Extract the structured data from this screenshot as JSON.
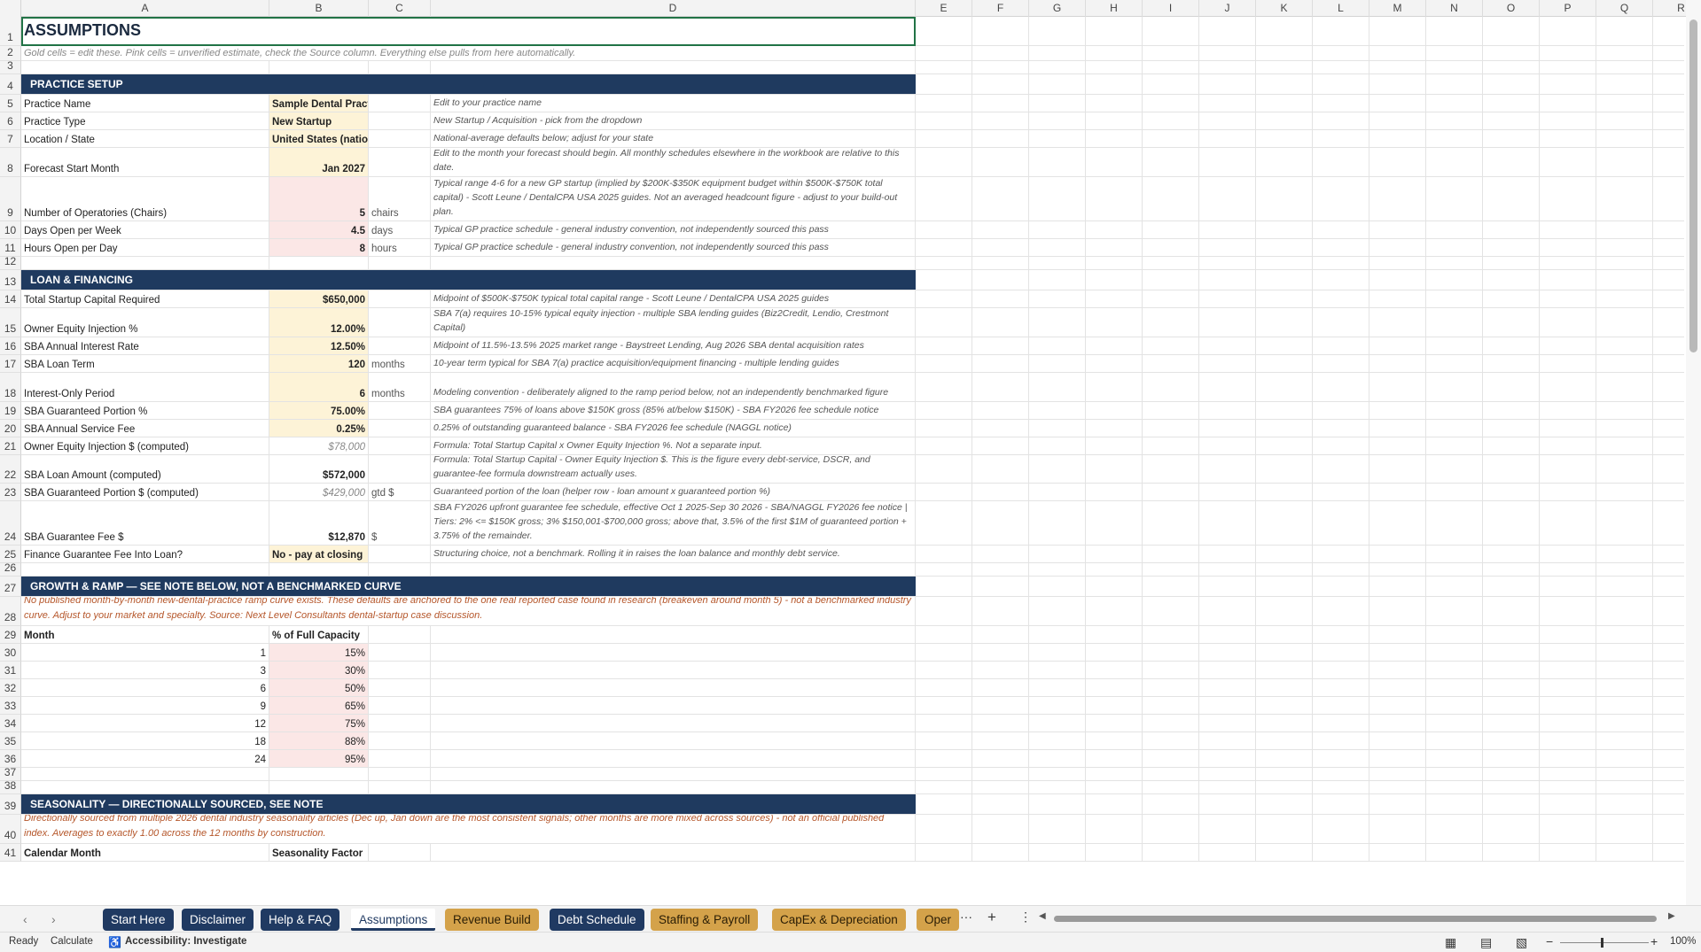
{
  "columns": [
    "A",
    "B",
    "C",
    "D",
    "E",
    "F",
    "G",
    "H",
    "I",
    "J",
    "K",
    "L",
    "M",
    "N",
    "O",
    "P",
    "Q",
    "R"
  ],
  "rows": [
    {
      "n": "1",
      "a": "ASSUMPTIONS",
      "kind": "title"
    },
    {
      "n": "2",
      "a": "Gold cells = edit these. Pink cells = unverified estimate, check the Source column. Everything else pulls from here automatically.",
      "kind": "subtitle"
    },
    {
      "n": "3",
      "kind": "blank"
    },
    {
      "n": "4",
      "a": "PRACTICE SETUP",
      "kind": "section"
    },
    {
      "n": "5",
      "a": "Practice Name",
      "b": "Sample Dental Practice",
      "bstyle": "gold-text",
      "d": "Edit to your practice name"
    },
    {
      "n": "6",
      "a": "Practice Type",
      "b": "New Startup",
      "bstyle": "gold-text",
      "d": "New Startup / Acquisition - pick from the dropdown"
    },
    {
      "n": "7",
      "a": "Location / State",
      "b": "United States (national avg.)",
      "bstyle": "gold-text",
      "d": "National-average defaults below; adjust for your state"
    },
    {
      "n": "8",
      "a": "Forecast Start Month",
      "b": "Jan 2027",
      "bstyle": "gold-num",
      "d": "Edit to the month your forecast should begin. All monthly schedules elsewhere in the workbook are relative to this date.",
      "tall": true
    },
    {
      "n": "9",
      "a": "Number of Operatories (Chairs)",
      "b": "5",
      "bstyle": "pink-num",
      "c": "chairs",
      "d": "Typical range 4-6 for a new GP startup (implied by $200K-$350K equipment budget within $500K-$750K total capital) - Scott Leune / DentalCPA USA 2025 guides. Not an averaged headcount figure - adjust to your build-out plan.",
      "tall3": true
    },
    {
      "n": "10",
      "a": "Days Open per Week",
      "b": "4.5",
      "bstyle": "pink-num",
      "c": "days",
      "d": "Typical GP practice schedule - general industry convention, not independently sourced this pass"
    },
    {
      "n": "11",
      "a": "Hours Open per Day",
      "b": "8",
      "bstyle": "pink-num",
      "c": "hours",
      "d": "Typical GP practice schedule - general industry convention, not independently sourced this pass"
    },
    {
      "n": "12",
      "kind": "blank"
    },
    {
      "n": "13",
      "a": "LOAN & FINANCING",
      "kind": "section"
    },
    {
      "n": "14",
      "a": "Total Startup Capital Required",
      "b": "$650,000",
      "bstyle": "gold-num",
      "d": "Midpoint of $500K-$750K typical total capital range - Scott Leune / DentalCPA USA 2025 guides"
    },
    {
      "n": "15",
      "a": "Owner Equity Injection %",
      "b": "12.00%",
      "bstyle": "gold-num",
      "d": "SBA 7(a) requires 10-15% typical equity injection - multiple SBA lending guides (Biz2Credit, Lendio, Crestmont Capital)",
      "tall": true
    },
    {
      "n": "16",
      "a": "SBA Annual Interest Rate",
      "b": "12.50%",
      "bstyle": "gold-num",
      "d": "Midpoint of 11.5%-13.5% 2025 market range - Baystreet Lending, Aug 2026 SBA dental acquisition rates"
    },
    {
      "n": "17",
      "a": "SBA Loan Term",
      "b": "120",
      "bstyle": "gold-num",
      "c": "months",
      "d": "10-year term typical for SBA 7(a) practice acquisition/equipment financing - multiple lending guides"
    },
    {
      "n": "18",
      "a": "Interest-Only Period",
      "b": "6",
      "bstyle": "gold-num",
      "c": "months",
      "d": "Modeling convention - deliberately aligned to the ramp period below, not an independently benchmarked figure",
      "tall": true
    },
    {
      "n": "19",
      "a": "SBA Guaranteed Portion %",
      "b": "75.00%",
      "bstyle": "gold-num",
      "d": "SBA guarantees 75% of loans above $150K gross (85% at/below $150K) - SBA FY2026 fee schedule notice"
    },
    {
      "n": "20",
      "a": "SBA Annual Service Fee",
      "b": "0.25%",
      "bstyle": "gold-num",
      "d": "0.25% of outstanding guaranteed balance - SBA FY2026 fee schedule (NAGGL notice)"
    },
    {
      "n": "21",
      "a": "Owner Equity Injection $ (computed)",
      "b": "$78,000",
      "bstyle": "muted",
      "d": "Formula: Total Startup Capital x Owner Equity Injection %. Not a separate input."
    },
    {
      "n": "22",
      "a": "SBA Loan Amount (computed)",
      "b": "$572,000",
      "bstyle": "bold-num",
      "d": "Formula: Total Startup Capital - Owner Equity Injection $. This is the figure every debt-service, DSCR, and guarantee-fee formula downstream actually uses.",
      "tall3b": true
    },
    {
      "n": "23",
      "a": "SBA Guaranteed Portion $ (computed)",
      "b": "$429,000",
      "bstyle": "muted",
      "c": "gtd $",
      "d": "Guaranteed portion of the loan (helper row - loan amount x guaranteed portion %)"
    },
    {
      "n": "24",
      "a": "SBA Guarantee Fee $",
      "b": "$12,870",
      "bstyle": "bold-num",
      "c": "$",
      "d": "SBA FY2026 upfront guarantee fee schedule, effective Oct 1 2025-Sep 30 2026 - SBA/NAGGL FY2026 fee notice | Tiers: 2% <= $150K gross; 3% $150,001-$700,000 gross; above that, 3.5% of the first $1M of guaranteed portion + 3.75% of the remainder.",
      "tall3": true
    },
    {
      "n": "25",
      "a": "Finance Guarantee Fee Into Loan?",
      "b": "No - pay at closing",
      "bstyle": "gold-text",
      "d": "Structuring choice, not a benchmark. Rolling it in raises the loan balance and monthly debt service."
    },
    {
      "n": "26",
      "kind": "blank"
    },
    {
      "n": "27",
      "a": "GROWTH & RAMP  —  SEE NOTE BELOW, NOT A BENCHMARKED CURVE",
      "kind": "section"
    },
    {
      "n": "28",
      "a": "No published month-by-month new-dental-practice ramp curve exists. These defaults are anchored to the one real reported case found in research (breakeven around month 5) - not a benchmarked industry curve. Adjust to your market and specialty. Source: Next Level Consultants dental-startup case discussion.",
      "kind": "warn"
    },
    {
      "n": "29",
      "a": "Month",
      "b": "% of Full Capacity",
      "kind": "header"
    },
    {
      "n": "30",
      "a": "1",
      "b": "15%",
      "kind": "ramp"
    },
    {
      "n": "31",
      "a": "3",
      "b": "30%",
      "kind": "ramp"
    },
    {
      "n": "32",
      "a": "6",
      "b": "50%",
      "kind": "ramp"
    },
    {
      "n": "33",
      "a": "9",
      "b": "65%",
      "kind": "ramp"
    },
    {
      "n": "34",
      "a": "12",
      "b": "75%",
      "kind": "ramp"
    },
    {
      "n": "35",
      "a": "18",
      "b": "88%",
      "kind": "ramp"
    },
    {
      "n": "36",
      "a": "24",
      "b": "95%",
      "kind": "ramp"
    },
    {
      "n": "37",
      "kind": "blank"
    },
    {
      "n": "38",
      "kind": "blank"
    },
    {
      "n": "39",
      "a": "SEASONALITY  —  DIRECTIONALLY SOURCED, SEE NOTE",
      "kind": "section"
    },
    {
      "n": "40",
      "a": "Directionally sourced from multiple 2026 dental industry seasonality articles (Dec up, Jan down are the most consistent signals; other months are more mixed across sources) - not an official published index. Averages to exactly 1.00 across the 12 months by construction.",
      "kind": "warn"
    },
    {
      "n": "41",
      "a": "Calendar Month",
      "b": "Seasonality Factor",
      "kind": "header"
    }
  ],
  "tabs": [
    {
      "label": "Start Here",
      "style": "navy"
    },
    {
      "label": "Disclaimer",
      "style": "navy"
    },
    {
      "label": "Help & FAQ",
      "style": "navy"
    },
    {
      "label": "Assumptions",
      "style": "active"
    },
    {
      "label": "Revenue Build",
      "style": "gold"
    },
    {
      "label": "Debt Schedule",
      "style": "navy"
    },
    {
      "label": "Staffing & Payroll",
      "style": "gold"
    },
    {
      "label": "CapEx & Depreciation",
      "style": "gold"
    },
    {
      "label": "Oper",
      "style": "gold"
    }
  ],
  "tab_more": "···",
  "tab_add": "+",
  "status": {
    "ready": "Ready",
    "calculate": "Calculate",
    "accessibility": "Accessibility: Investigate",
    "zoom": "100%",
    "zoom_minus": "−",
    "zoom_plus": "+"
  },
  "colors": {
    "navy": "#1f3a5f",
    "gold_cell": "#fdf3d7",
    "pink_cell": "#fbe7e6",
    "warn_text": "#b5562a",
    "tab_gold": "#d4a24a"
  }
}
